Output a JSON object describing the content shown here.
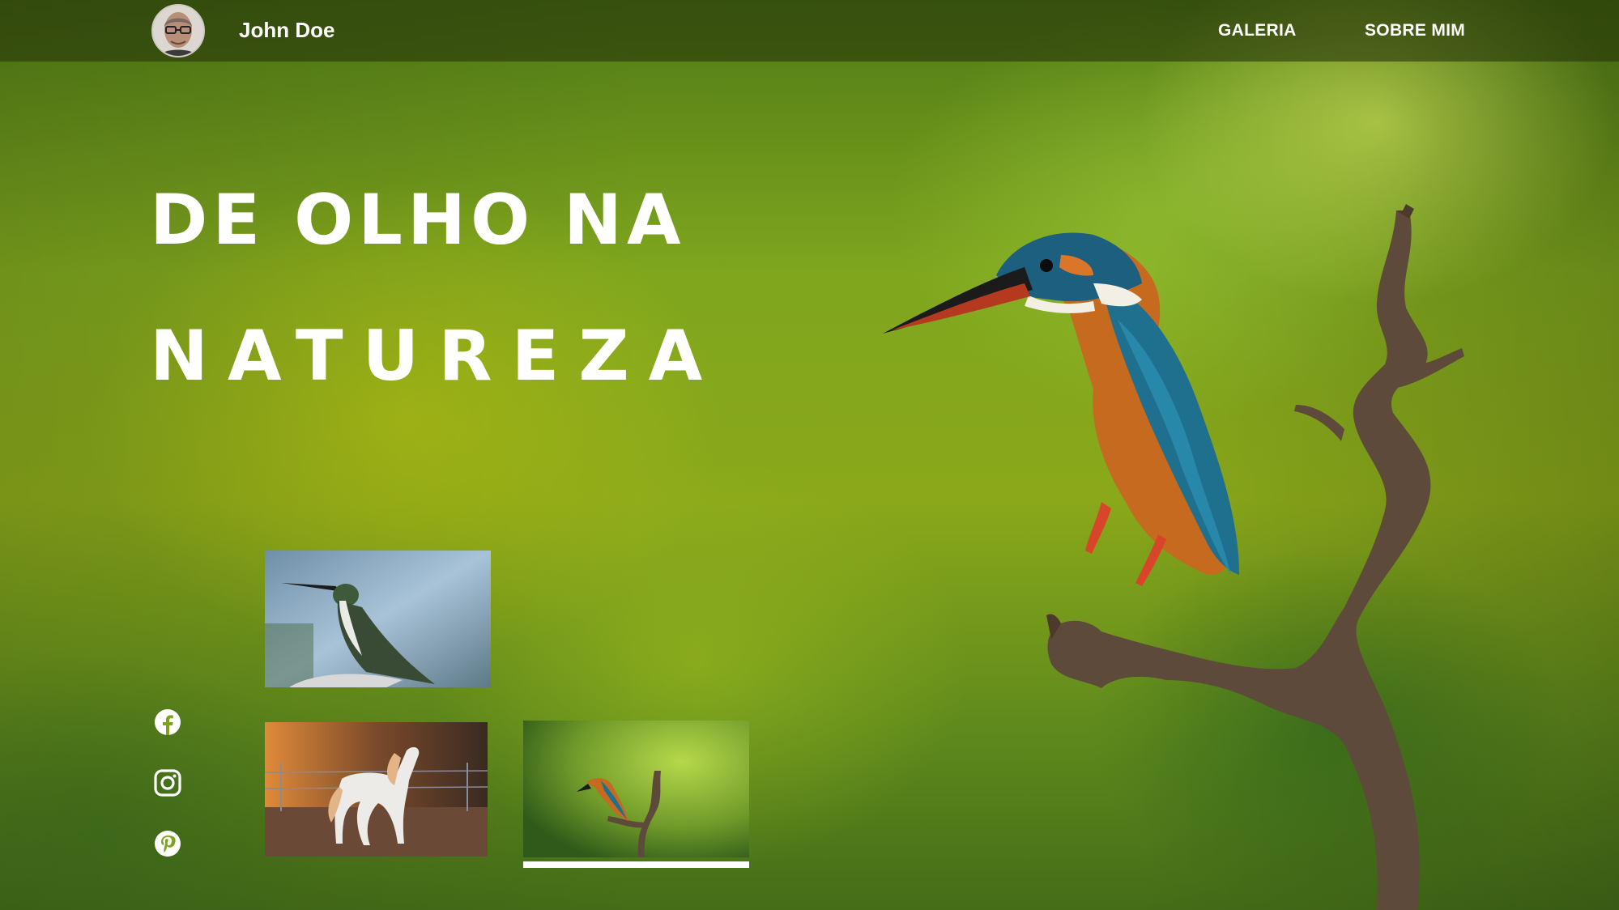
{
  "header": {
    "avatar_icon": "person-avatar-icon",
    "name": "John Doe",
    "nav": [
      {
        "label": "GALERIA"
      },
      {
        "label": "SOBRE MIM"
      }
    ]
  },
  "hero": {
    "title_line1": "DE OLHO NA",
    "title_line2": "NATUREZA"
  },
  "social": [
    {
      "icon": "facebook-icon"
    },
    {
      "icon": "instagram-icon"
    },
    {
      "icon": "pinterest-icon"
    }
  ],
  "gallery": {
    "thumbnails": [
      {
        "subject": "hummingbird"
      },
      {
        "subject": "white horse"
      },
      {
        "subject": "kingfisher",
        "selected": true
      }
    ]
  },
  "colors": {
    "accent": "#ffffff",
    "header_bg": "#28370a",
    "background": "#7fa61e"
  }
}
